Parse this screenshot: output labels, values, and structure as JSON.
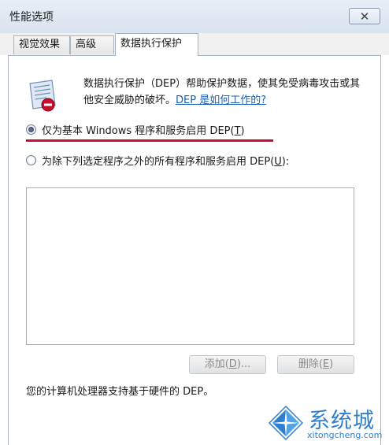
{
  "window": {
    "title": "性能选项",
    "close_glyph": "✕"
  },
  "tabs": [
    {
      "label": "视觉效果",
      "active": false
    },
    {
      "label": "高级",
      "active": false
    },
    {
      "label": "数据执行保护",
      "active": true
    }
  ],
  "description": {
    "text": "数据执行保护（DEP）帮助保护数据，使其免受病毒攻击或其他安全威胁的破坏。",
    "link": "DEP 是如何工作的?"
  },
  "options": [
    {
      "label": "仅为基本 Windows 程序和服务启用 DEP(",
      "mnemonic": "T",
      "suffix": ")",
      "selected": true
    },
    {
      "label": "为除下列选定程序之外的所有程序和服务启用 DEP(",
      "mnemonic": "U",
      "suffix": "):",
      "selected": false
    }
  ],
  "buttons": {
    "add": {
      "label": "添加(",
      "mnemonic": "D",
      "suffix": ")..."
    },
    "remove": {
      "label": "删除(",
      "mnemonic": "E",
      "suffix": ")"
    }
  },
  "footer": "您的计算机处理器支持基于硬件的 DEP。",
  "watermark": {
    "title": "系统城",
    "subtitle": "xitongcheng.com"
  },
  "colors": {
    "highlight_underline": "#c8102e",
    "link": "#1a5fb4",
    "watermark": "#2f7fd0"
  },
  "icons": {
    "dep": "dep-shield-icon",
    "close": "close-icon",
    "watermark_logo": "windows-logo-icon"
  }
}
